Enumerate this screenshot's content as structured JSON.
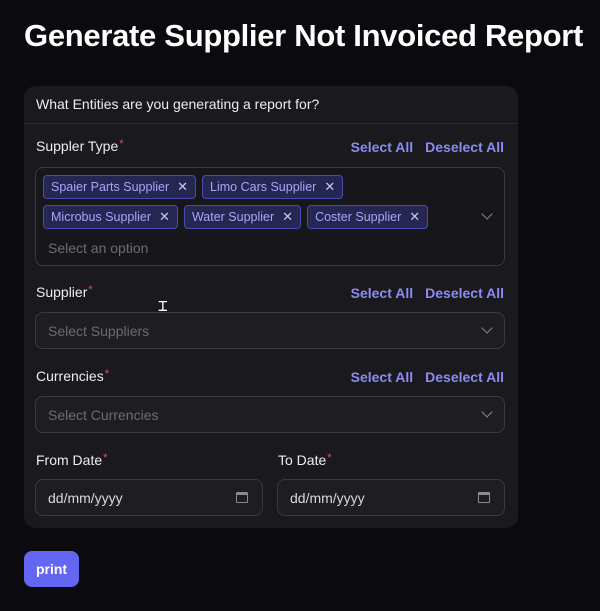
{
  "page": {
    "title": "Generate Supplier Not Invoiced Report"
  },
  "card": {
    "header": "What Entities are you generating a report for?",
    "supplier_type": {
      "label": "Suppler Type",
      "select_all": "Select All",
      "deselect_all": "Deselect All",
      "chips_row1": [
        "Spaier Parts Supplier",
        "Limo Cars Supplier"
      ],
      "chips_row2": [
        "Microbus Supplier",
        "Water Supplier",
        "Coster Supplier"
      ],
      "placeholder": "Select an option"
    },
    "supplier": {
      "label": "Supplier",
      "select_all": "Select All",
      "deselect_all": "Deselect All",
      "placeholder": "Select Suppliers"
    },
    "currencies": {
      "label": "Currencies",
      "select_all": "Select All",
      "deselect_all": "Deselect All",
      "placeholder": "Select Currencies"
    },
    "from_date": {
      "label": "From Date",
      "value": "dd/mm/yyyy"
    },
    "to_date": {
      "label": "To Date",
      "value": "dd/mm/yyyy"
    }
  },
  "actions": {
    "print_label": "print"
  },
  "icons": {
    "chip_remove": "close-icon",
    "dropdown": "chevron-down-icon",
    "date_picker": "calendar-icon",
    "mouse_cursor": "text-cursor-icon"
  },
  "colors": {
    "accent": "#6366f1",
    "link": "#8b8cf0",
    "required": "#e05260",
    "background": "#0b0a0e",
    "card": "#1a191e"
  }
}
